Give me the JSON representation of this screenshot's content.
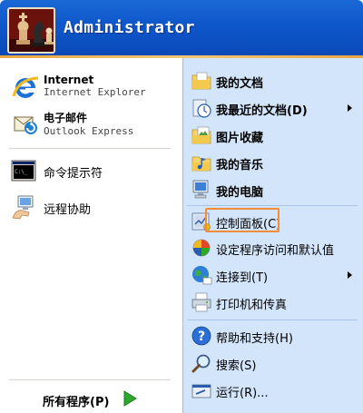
{
  "user": {
    "name": "Administrator"
  },
  "pinned": [
    {
      "title": "Internet",
      "subtitle": "Internet Explorer",
      "icon": "ie-icon"
    },
    {
      "title": "电子邮件",
      "subtitle": "Outlook Express",
      "icon": "outlook-express-icon"
    }
  ],
  "recent": [
    {
      "label": "命令提示符",
      "icon": "command-prompt-icon"
    },
    {
      "label": "远程协助",
      "icon": "remote-assistance-icon"
    }
  ],
  "all_programs": {
    "label": "所有程序(P)",
    "icon": "green-arrow-icon"
  },
  "places": [
    {
      "label": "我的文档",
      "icon": "my-documents-icon",
      "bold": true
    },
    {
      "label": "我最近的文档(D)",
      "icon": "recent-documents-icon",
      "bold": true,
      "submenu": true
    },
    {
      "label": "图片收藏",
      "icon": "my-pictures-icon",
      "bold": true
    },
    {
      "label": "我的音乐",
      "icon": "my-music-icon",
      "bold": true
    },
    {
      "label": "我的电脑",
      "icon": "my-computer-icon",
      "bold": true
    },
    {
      "label": "控制面板(C)",
      "icon": "control-panel-icon",
      "highlighted": true
    },
    {
      "label": "设定程序访问和默认值",
      "icon": "program-access-icon"
    },
    {
      "label": "连接到(T)",
      "icon": "connect-to-icon",
      "submenu": true
    },
    {
      "label": "打印机和传真",
      "icon": "printers-icon"
    },
    {
      "label": "帮助和支持(H)",
      "icon": "help-icon"
    },
    {
      "label": "搜索(S)",
      "icon": "search-icon"
    },
    {
      "label": "运行(R)...",
      "icon": "run-icon"
    }
  ],
  "colors": {
    "header_blue": "#0f58cc",
    "right_pane": "#d3e5fa",
    "highlight_border": "#f08c3a",
    "accent_orange": "#e8a640"
  }
}
